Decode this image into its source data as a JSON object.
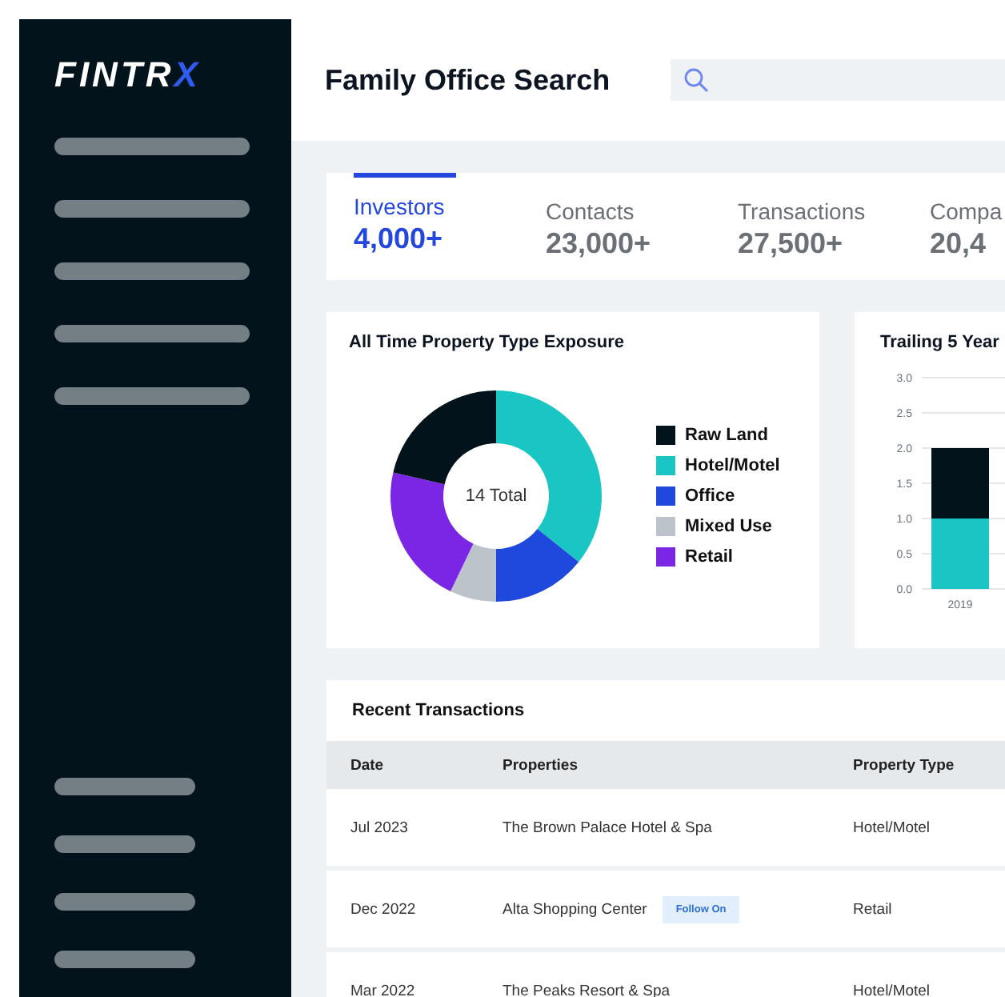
{
  "logo": {
    "main": "FINTR",
    "accent": "X"
  },
  "header": {
    "title": "Family Office Search"
  },
  "stats": [
    {
      "label": "Investors",
      "value": "4,000+",
      "selected": true
    },
    {
      "label": "Contacts",
      "value": "23,000+",
      "selected": false
    },
    {
      "label": "Transactions",
      "value": "27,500+",
      "selected": false
    },
    {
      "label": "Compa",
      "value": "20,4",
      "selected": false
    }
  ],
  "exposure": {
    "title": "All Time Property Type Exposure",
    "center_label": "14 Total",
    "chart_data": {
      "type": "donut",
      "categories": [
        "Raw Land",
        "Hotel/Motel",
        "Office",
        "Mixed Use",
        "Retail"
      ],
      "values": [
        21.4,
        35.7,
        14.3,
        7.1,
        21.5
      ]
    },
    "legend": [
      {
        "color": "#03131c"
      },
      {
        "color": "#19c6c4"
      },
      {
        "color": "#1f48dc"
      },
      {
        "color": "#bcc3cb"
      },
      {
        "color": "#7a26e4"
      }
    ]
  },
  "trailing": {
    "title": "Trailing 5 Year",
    "chart_data": {
      "type": "bar",
      "stacked": true,
      "grid": true,
      "categories": [
        "2019"
      ],
      "ylim": [
        0,
        3
      ],
      "yticks": [
        {
          "value": 0,
          "label": "0.0"
        },
        {
          "value": 0.5,
          "label": "0.5"
        },
        {
          "value": 1,
          "label": "1.0"
        },
        {
          "value": 1.5,
          "label": "1.5"
        },
        {
          "value": 2,
          "label": "2.0"
        },
        {
          "value": 2.5,
          "label": "2.5"
        },
        {
          "value": 3,
          "label": "3.0"
        }
      ],
      "series": [
        {
          "color": "#19c6c4",
          "values": [
            1
          ]
        },
        {
          "color": "#03131c",
          "values": [
            1
          ]
        }
      ]
    }
  },
  "transactions": {
    "title": "Recent Transactions",
    "columns": [
      "Date",
      "Properties",
      "Property Type"
    ],
    "rows": [
      {
        "date": "Jul 2023",
        "property": "The Brown Palace Hotel & Spa",
        "type": "Hotel/Motel"
      },
      {
        "date": "Dec 2022",
        "property": "Alta Shopping Center",
        "badge": "Follow On",
        "type": "Retail"
      },
      {
        "date": "Mar 2022",
        "property": "The Peaks Resort & Spa",
        "type": "Hotel/Motel"
      }
    ]
  }
}
